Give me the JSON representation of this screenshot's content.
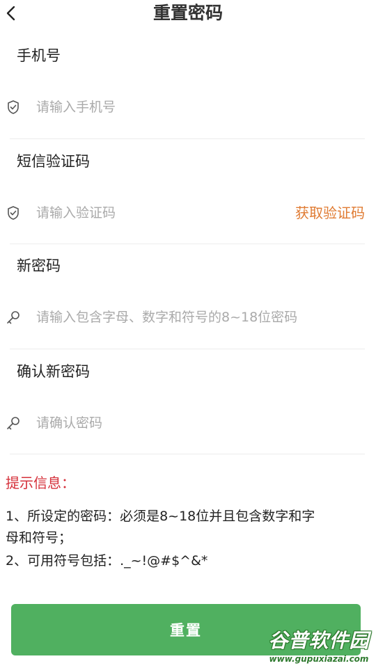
{
  "header": {
    "title": "重置密码",
    "back_icon": "chevron-left-icon"
  },
  "fields": {
    "phone": {
      "label": "手机号",
      "placeholder": "请输入手机号",
      "icon": "shield-check-icon"
    },
    "sms_code": {
      "label": "短信验证码",
      "placeholder": "请输入验证码",
      "icon": "shield-check-icon",
      "get_code_label": "获取验证码"
    },
    "new_password": {
      "label": "新密码",
      "placeholder": "请输入包含字母、数字和符号的8~18位密码",
      "icon": "key-icon"
    },
    "confirm_password": {
      "label": "确认新密码",
      "placeholder": "请确认密码",
      "icon": "key-icon"
    }
  },
  "hint": {
    "title": "提示信息：",
    "line1a": "1、所设定的密码：必须是8~18位并且包含数字和字",
    "line1b": "母和符号；",
    "line2": "2、可用符号包括：._~!@#$^&*"
  },
  "submit_label": "重置",
  "watermark": {
    "logo_text": "谷普软件园",
    "url": "www.gupuxiazai.com"
  },
  "colors": {
    "primary_button": "#50b060",
    "link_orange": "#e07b32",
    "hint_red": "#d5303a",
    "placeholder_gray": "#aaaaaa"
  }
}
